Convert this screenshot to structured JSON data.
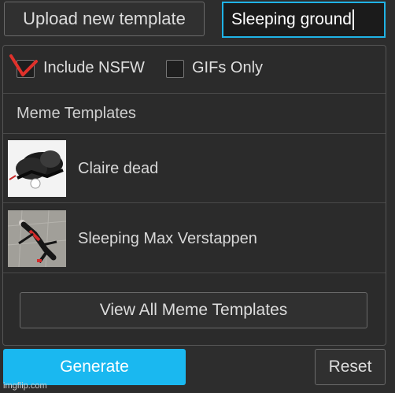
{
  "toolbar": {
    "upload_label": "Upload new template"
  },
  "search": {
    "value": "Sleeping ground"
  },
  "filters": {
    "nsfw": {
      "label": "Include NSFW",
      "checked": false
    },
    "gifs": {
      "label": "GIFs Only",
      "checked": false
    }
  },
  "templates": {
    "heading": "Meme Templates",
    "items": [
      {
        "label": "Claire dead",
        "thumbnail_icon": "meme-thumbnail-icon"
      },
      {
        "label": "Sleeping Max Verstappen",
        "thumbnail_icon": "meme-thumbnail-icon"
      }
    ],
    "view_all_label": "View All Meme Templates"
  },
  "actions": {
    "generate_label": "Generate",
    "reset_label": "Reset"
  },
  "watermark": "imgflip.com",
  "colors": {
    "accent": "#1ab8f0",
    "background": "#2d2d2d",
    "annotation": "#e0312b"
  }
}
